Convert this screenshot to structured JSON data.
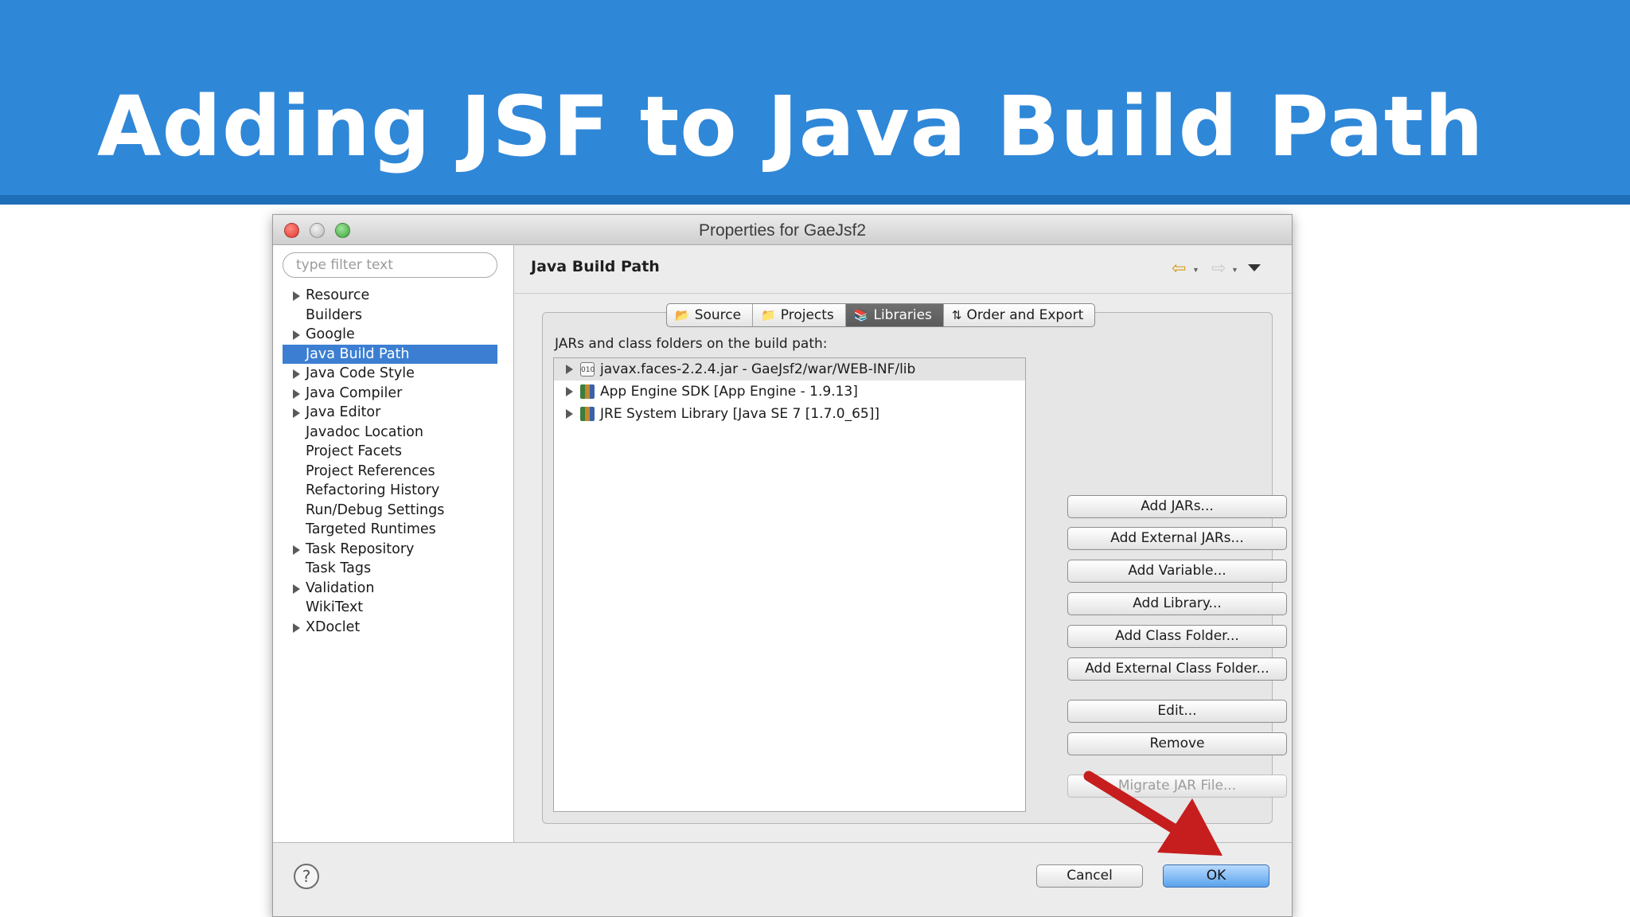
{
  "slide": {
    "title": "Adding JSF to Java Build Path"
  },
  "window": {
    "title": "Properties for GaeJsf2"
  },
  "filter": {
    "placeholder": "type filter text"
  },
  "tree": [
    {
      "label": "Resource",
      "expandable": true
    },
    {
      "label": "Builders",
      "expandable": false
    },
    {
      "label": "Google",
      "expandable": true
    },
    {
      "label": "Java Build Path",
      "expandable": false,
      "selected": true
    },
    {
      "label": "Java Code Style",
      "expandable": true
    },
    {
      "label": "Java Compiler",
      "expandable": true
    },
    {
      "label": "Java Editor",
      "expandable": true
    },
    {
      "label": "Javadoc Location",
      "expandable": false
    },
    {
      "label": "Project Facets",
      "expandable": false
    },
    {
      "label": "Project References",
      "expandable": false
    },
    {
      "label": "Refactoring History",
      "expandable": false
    },
    {
      "label": "Run/Debug Settings",
      "expandable": false
    },
    {
      "label": "Targeted Runtimes",
      "expandable": false
    },
    {
      "label": "Task Repository",
      "expandable": true
    },
    {
      "label": "Task Tags",
      "expandable": false
    },
    {
      "label": "Validation",
      "expandable": true
    },
    {
      "label": "WikiText",
      "expandable": false
    },
    {
      "label": "XDoclet",
      "expandable": true
    }
  ],
  "page": {
    "title": "Java Build Path"
  },
  "tabs": [
    {
      "label": "Source",
      "icon": "source-folder-icon"
    },
    {
      "label": "Projects",
      "icon": "projects-folder-icon"
    },
    {
      "label": "Libraries",
      "icon": "libraries-icon",
      "active": true
    },
    {
      "label": "Order and Export",
      "icon": "order-export-icon"
    }
  ],
  "libraries": {
    "label": "JARs and class folders on the build path:",
    "items": [
      {
        "label": "javax.faces-2.2.4.jar - GaeJsf2/war/WEB-INF/lib",
        "icon": "jar-icon",
        "selected": true
      },
      {
        "label": "App Engine SDK [App Engine - 1.9.13]",
        "icon": "library-icon"
      },
      {
        "label": "JRE System Library [Java SE 7 [1.7.0_65]]",
        "icon": "library-icon"
      }
    ]
  },
  "buttons": {
    "add_jars": "Add JARs...",
    "add_external_jars": "Add External JARs...",
    "add_variable": "Add Variable...",
    "add_library": "Add Library...",
    "add_class_folder": "Add Class Folder...",
    "add_external_class_folder": "Add External Class Folder...",
    "edit": "Edit...",
    "remove": "Remove",
    "migrate_jar": "Migrate JAR File..."
  },
  "footer": {
    "help": "?",
    "cancel": "Cancel",
    "ok": "OK"
  },
  "colors": {
    "header": "#2f87d8",
    "selection": "#3c7fd2",
    "annotation_arrow": "#c61e1e"
  }
}
